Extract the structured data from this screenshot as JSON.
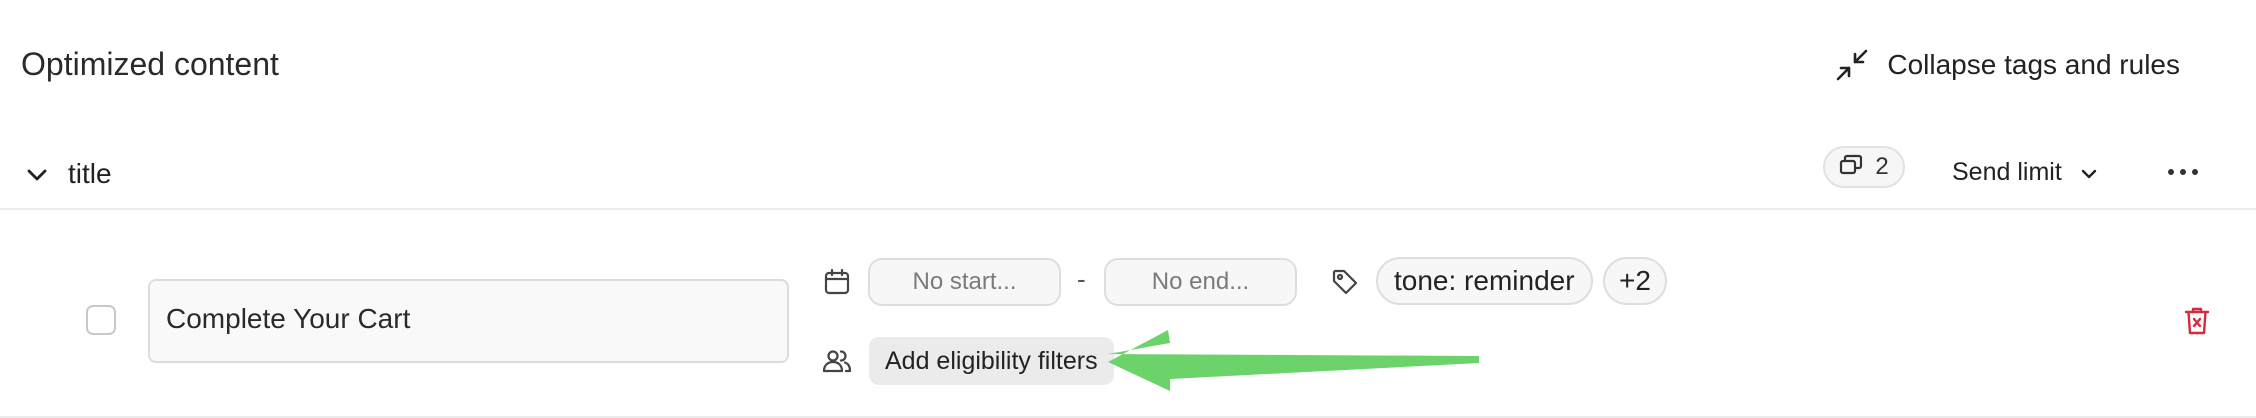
{
  "header": {
    "title": "Optimized content",
    "collapse_label": "Collapse tags and rules",
    "collapse_icon": "collapse-arrows-icon"
  },
  "group": {
    "title": "title",
    "variants_count": "2",
    "send_limit_label": "Send limit"
  },
  "item": {
    "title_value": "Complete Your Cart",
    "start_placeholder": "No start...",
    "date_separator": "-",
    "end_placeholder": "No end...",
    "tags": [
      "tone: reminder",
      "+2"
    ],
    "filters_button": "Add eligibility filters"
  },
  "colors": {
    "delete": "#d62b3c",
    "annotation_arrow": "#6cd26a"
  }
}
